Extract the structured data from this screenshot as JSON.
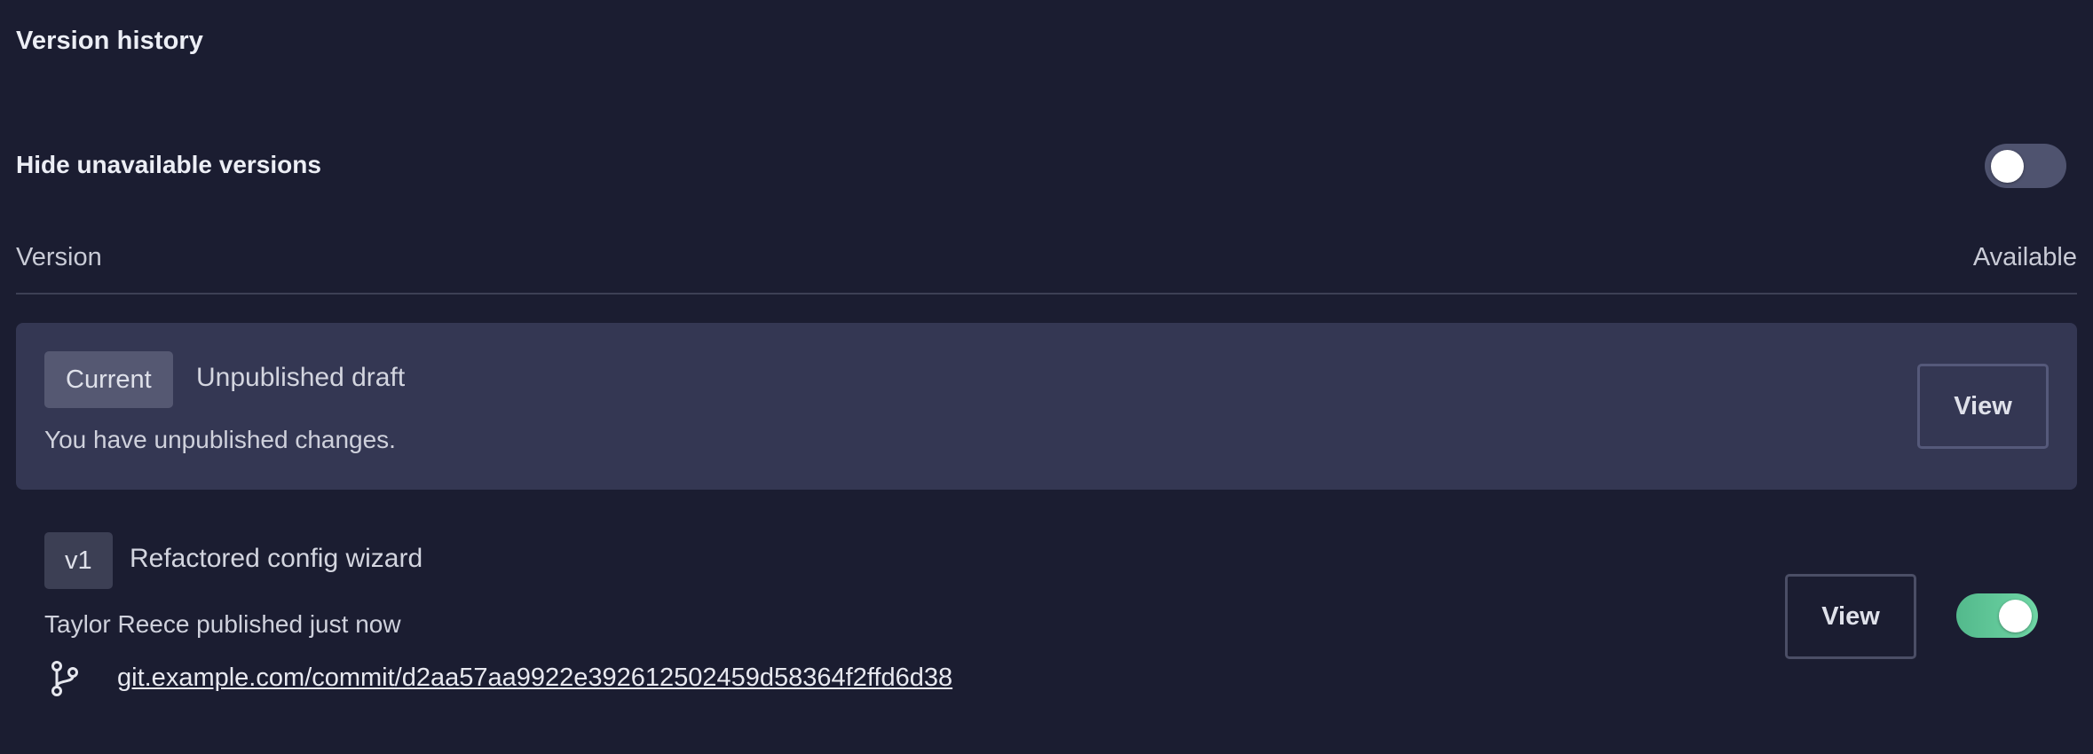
{
  "panel": {
    "title": "Version history"
  },
  "filter": {
    "hide_unavailable_label": "Hide unavailable versions",
    "hide_unavailable_enabled": false
  },
  "columns": {
    "version": "Version",
    "available": "Available"
  },
  "versions": [
    {
      "badge": "Current",
      "title": "Unpublished draft",
      "description": "You have unpublished changes.",
      "view_label": "View"
    },
    {
      "badge": "v1",
      "title": "Refactored config wizard",
      "description": "Taylor Reece published just now",
      "commit_url": "git.example.com/commit/d2aa57aa9922e392612502459d58364f2ffd6d38",
      "commit_icon": "git-branch-icon",
      "view_label": "View",
      "available": true
    }
  ],
  "colors": {
    "background": "#1b1d31",
    "current_card": "#343753",
    "toggle_on": "#6fd6a5",
    "toggle_off": "#4f536f"
  }
}
